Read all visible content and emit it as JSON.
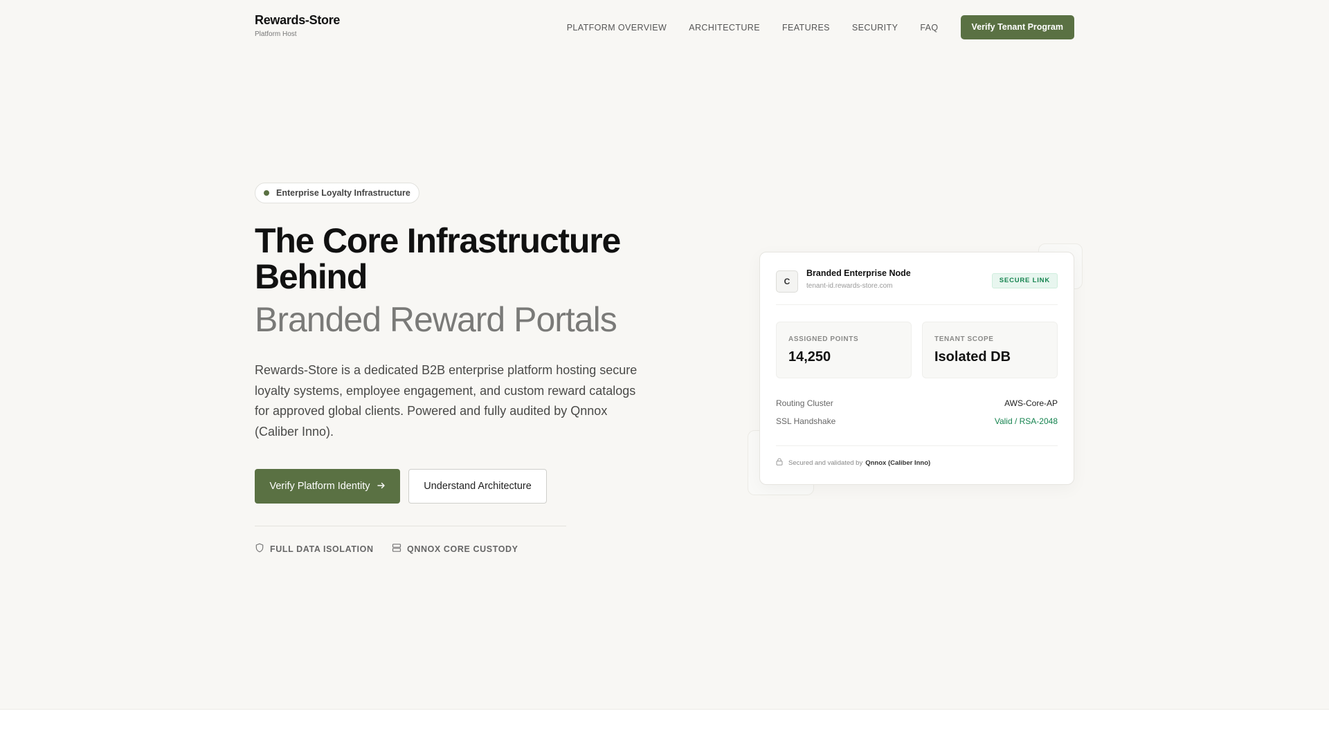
{
  "header": {
    "brand_name": "Rewards-Store",
    "brand_sub": "Platform Host",
    "nav": [
      "PLATFORM OVERVIEW",
      "ARCHITECTURE",
      "FEATURES",
      "SECURITY",
      "FAQ"
    ],
    "cta": "Verify Tenant Program"
  },
  "hero": {
    "badge": "Enterprise Loyalty Infrastructure",
    "title": "The Core Infrastructure Behind",
    "subtitle": "Branded Reward Portals",
    "lead": "Rewards-Store is a dedicated B2B enterprise platform hosting secure loyalty systems, employee engagement, and custom reward catalogs for approved global clients. Powered and fully audited by Qnnox (Caliber Inno).",
    "primary_button": "Verify Platform Identity",
    "secondary_button": "Understand Architecture",
    "trust_items": [
      {
        "icon": "shield-icon",
        "label": "FULL DATA ISOLATION"
      },
      {
        "icon": "server-icon",
        "label": "QNNOX CORE CUSTODY"
      }
    ]
  },
  "card": {
    "icon_letter": "C",
    "title": "Branded Enterprise Node",
    "host": "tenant-id.rewards-store.com",
    "badge": "SECURE LINK",
    "stats": [
      {
        "label": "ASSIGNED POINTS",
        "value": "14,250"
      },
      {
        "label": "TENANT SCOPE",
        "value": "Isolated DB"
      }
    ],
    "rows": [
      {
        "key": "Routing Cluster",
        "value": "AWS-Core-AP",
        "status": "normal"
      },
      {
        "key": "SSL Handshake",
        "value": "Valid / RSA-2048",
        "status": "ok"
      }
    ],
    "footer_prefix": "Secured and validated by",
    "footer_org": "Qnnox (Caliber Inno)"
  },
  "colors": {
    "accent": "#5a7143",
    "success": "#15834f",
    "background": "#f8f7f4"
  }
}
